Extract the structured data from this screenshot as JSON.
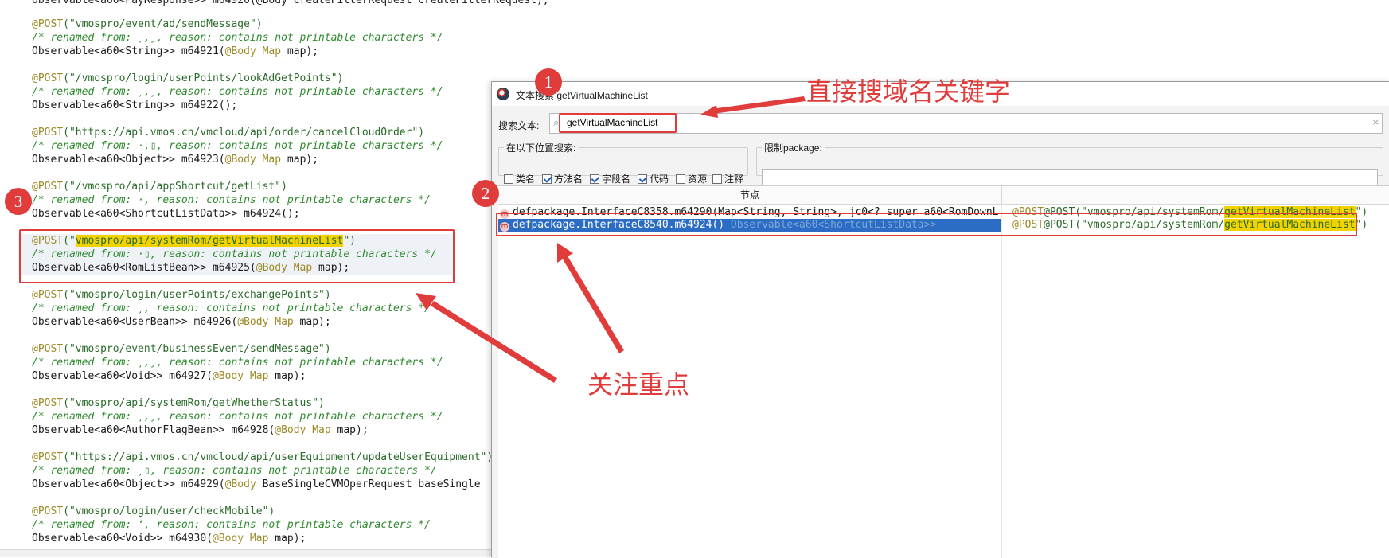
{
  "editor": {
    "top_partial": "Observable<a60<PayResponse>> m64920(@Body CreateFilterRequest createFilterRequest);",
    "blocks": [
      {
        "path": "vmospro/event/ad/sendMessage",
        "comment": "/* renamed from: ¸,¸, reason: contains not printable characters */",
        "prefix": "Observable<a60<String>> m64921(",
        "annot_arg": "@Body Map",
        "suffix": " map);"
      },
      {
        "path": "/vmospro/login/userPoints/lookAdGetPoints",
        "comment": "/* renamed from: ¸,¸, reason: contains not printable characters */",
        "prefix": "Observable<a60<String>> m64922();",
        "annot_arg": "",
        "suffix": ""
      },
      {
        "path": "https://api.vmos.cn/vmcloud/api/order/cancelCloudOrder",
        "comment": "/* renamed from: ·,▯, reason: contains not printable characters */",
        "prefix": "Observable<a60<Object>> m64923(",
        "annot_arg": "@Body Map",
        "suffix": " map);"
      },
      {
        "path": "/vmospro/api/appShortcut/getList",
        "comment": "/* renamed from: ·, reason: contains not printable characters */",
        "prefix": "Observable<a60<ShortcutListData>> m64924();",
        "annot_arg": "",
        "suffix": ""
      },
      {
        "path": "vmospro/api/systemRom/getVirtualMachineList",
        "comment": "/* renamed from: ·▯, reason: contains not printable characters */",
        "prefix": "Observable<a60<RomListBean>> m64925(",
        "annot_arg": "@Body Map",
        "suffix": " map);"
      },
      {
        "path": "vmospro/login/userPoints/exchangePoints",
        "comment": "/* renamed from: ¸, reason: contains not printable characters */",
        "prefix": "Observable<a60<UserBean>> m64926(",
        "annot_arg": "@Body Map",
        "suffix": " map);"
      },
      {
        "path": "vmospro/event/businessEvent/sendMessage",
        "comment": "/* renamed from: ¸,¸, reason: contains not printable characters */",
        "prefix": "Observable<a60<Void>> m64927(",
        "annot_arg": "@Body Map",
        "suffix": " map);"
      },
      {
        "path": "vmospro/api/systemRom/getWhetherStatus",
        "comment": "/* renamed from: ¸,¸, reason: contains not printable characters */",
        "prefix": "Observable<a60<AuthorFlagBean>> m64928(",
        "annot_arg": "@Body Map",
        "suffix": " map);"
      },
      {
        "path": "https://api.vmos.cn/vmcloud/api/userEquipment/updateUserEquipment",
        "comment": "/* renamed from: ¸▯, reason: contains not printable characters */",
        "prefix": "Observable<a60<Object>> m64929(",
        "annot_arg": "@Body",
        "suffix": " BaseSingleCVMOperRequest baseSingle"
      },
      {
        "path": "vmospro/login/user/checkMobile",
        "comment": "/* renamed from: ‘, reason: contains not printable characters */",
        "prefix": "Observable<a60<Void>> m64930(",
        "annot_arg": "@Body Map",
        "suffix": " map);"
      }
    ],
    "post_annotation": "@POST"
  },
  "dialog": {
    "title": "文本搜索 getVirtualMachineList",
    "search_label": "搜索文本:",
    "search_value": "getVirtualMachineList",
    "where_group_label": "在以下位置搜索:",
    "checkboxes": [
      {
        "label": "类名",
        "checked": false
      },
      {
        "label": "方法名",
        "checked": true
      },
      {
        "label": "字段名",
        "checked": true
      },
      {
        "label": "代码",
        "checked": true
      },
      {
        "label": "资源",
        "checked": false
      },
      {
        "label": "注释",
        "checked": false
      }
    ],
    "package_group_label": "限制package:",
    "package_value": "",
    "results_header_node": "节点",
    "results": [
      {
        "node": "defpackage.InterfaceC8358.m64290(Map<String, String>, jc0<? super a60<RomDownL",
        "signature": "",
        "code_prefix": "@POST(\"vmospro/api/systemRom/",
        "code_match": "getVirtualMachineList",
        "code_suffix": "\")",
        "selected": false
      },
      {
        "node": "defpackage.InterfaceC8540.m64924()",
        "signature": " Observable<a60<ShortcutListData>>",
        "code_prefix": "@POST(\"vmospro/api/systemRom/",
        "code_match": "getVirtualMachineList",
        "code_suffix": "\")",
        "selected": true
      }
    ]
  },
  "annotations": {
    "badge1": "1",
    "badge2": "2",
    "badge3": "3",
    "note_search": "直接搜域名关键字",
    "note_focus": "关注重点"
  },
  "colors": {
    "annotation_red": "#e03c3c",
    "selection_blue": "#2b6cc4",
    "match_yellow": "#f2d200"
  }
}
